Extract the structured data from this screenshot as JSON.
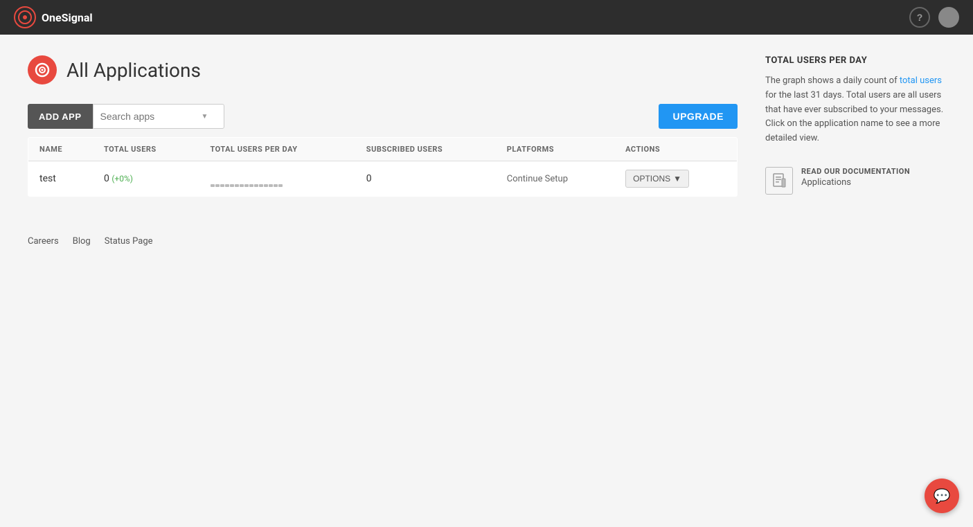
{
  "topnav": {
    "logo_text_part1": "One",
    "logo_text_part2": "Signal",
    "help_label": "?",
    "avatar_alt": "User avatar"
  },
  "page": {
    "title": "All Applications",
    "icon_alt": "onesignal-logo-icon"
  },
  "toolbar": {
    "add_app_label": "ADD APP",
    "search_placeholder": "Search apps",
    "upgrade_label": "UPGRADE"
  },
  "table": {
    "columns": [
      "NAME",
      "TOTAL USERS",
      "TOTAL USERS PER DAY",
      "SUBSCRIBED USERS",
      "PLATFORMS",
      "ACTIONS"
    ],
    "rows": [
      {
        "name": "test",
        "total_users": "0",
        "change": "(+0%)",
        "total_users_per_day": "",
        "subscribed_users": "0",
        "platforms": "Continue Setup",
        "actions_label": "OPTIONS"
      }
    ]
  },
  "sidebar": {
    "section_title": "TOTAL USERS PER DAY",
    "description": "The graph shows a daily count of total users for the last 31 days. Total users are all users that have ever subscribed to your messages. Click on the application name to see a more detailed view.",
    "description_highlight": "Total",
    "doc_read_label": "READ OUR DOCUMENTATION",
    "doc_app_label": "Applications"
  },
  "footer": {
    "links": [
      "Careers",
      "Blog",
      "Status Page"
    ]
  }
}
